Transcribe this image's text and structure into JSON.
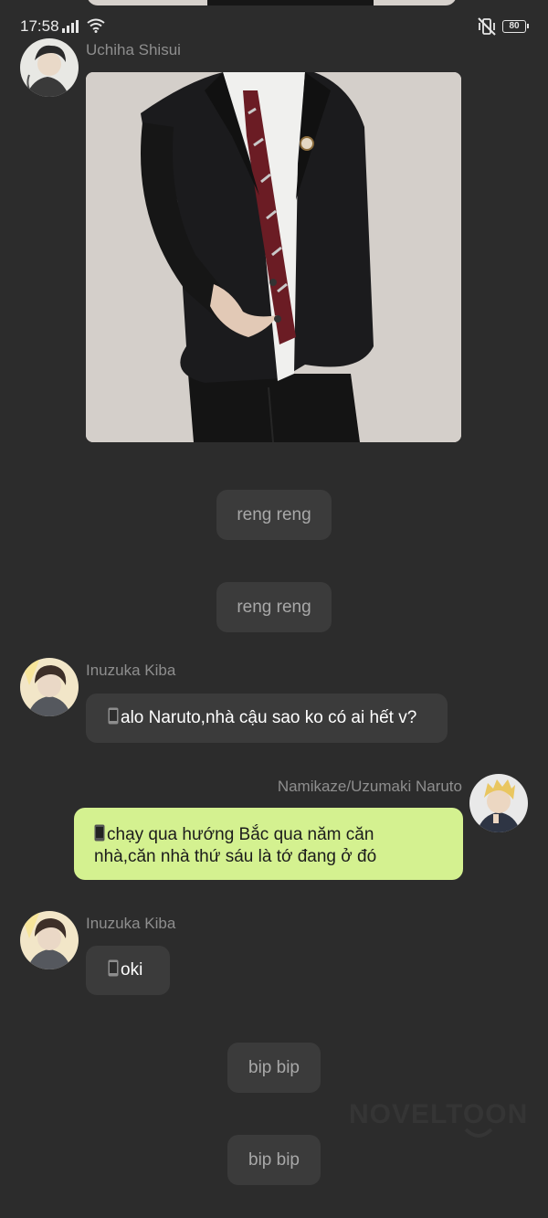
{
  "status_bar": {
    "time": "17:58",
    "battery": "80",
    "signal_icon": "signal-bars-icon",
    "wifi_icon": "wifi-icon",
    "mute_icon": "vibrate-mute-icon"
  },
  "messages": [
    {
      "type": "image",
      "sender": "Uchiha Shisui",
      "avatar": "avatar-uchiha-shisui"
    },
    {
      "type": "system",
      "text": "reng reng"
    },
    {
      "type": "system",
      "text": "reng reng"
    },
    {
      "type": "text",
      "sender": "Inuzuka Kiba",
      "side": "left",
      "icon": "phone-icon",
      "text": "alo Naruto,nhà cậu sao ko có ai hết v?"
    },
    {
      "type": "text",
      "sender": "Namikaze/Uzumaki Naruto",
      "side": "right",
      "icon": "phone-icon",
      "lines": [
        "chạy qua hướng Bắc qua năm căn",
        "nhà,căn nhà thứ sáu là tớ đang ở đó"
      ]
    },
    {
      "type": "text",
      "sender": "Inuzuka Kiba",
      "side": "left",
      "icon": "phone-icon",
      "text": "oki"
    },
    {
      "type": "system",
      "text": "bip bip"
    },
    {
      "type": "system",
      "text": "bip bip"
    }
  ],
  "watermark": "NOVELTOON",
  "colors": {
    "background": "#2c2c2c",
    "bubble": "#3b3b3b",
    "self_bubble": "#d4f190",
    "name": "#8e8e8e"
  }
}
